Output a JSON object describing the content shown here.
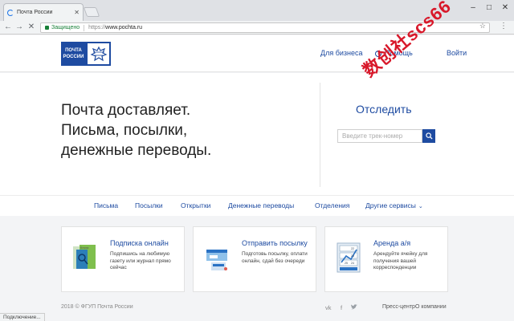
{
  "browser": {
    "tab_title": "Почта России",
    "secure_label": "Защищено",
    "url_protocol": "https://",
    "url_host": "www.pochta.ru",
    "status_text": "Подключение..."
  },
  "header": {
    "logo_line1": "ПОЧТА",
    "logo_line2": "РОССИИ",
    "business_link": "Для бизнеса",
    "help_link": "Помощь",
    "login_link": "Войти"
  },
  "hero": {
    "tagline_line1": "Почта доставляет.",
    "tagline_line2": "Письма, посылки,",
    "tagline_line3": "денежные переводы.",
    "track_title": "Отследить",
    "track_placeholder": "Введите трек-номер"
  },
  "nav": {
    "items": [
      "Письма",
      "Посылки",
      "Открытки",
      "Денежные переводы",
      "Отделения",
      "Другие сервисы"
    ]
  },
  "cards": [
    {
      "title": "Подписка онлайн",
      "desc": "Подпишись на любимую газету или журнал прямо сейчас",
      "illus_label": "Книга"
    },
    {
      "title": "Отправить посылку",
      "desc": "Подготовь посылку, оплати онлайн, сдай без очереди"
    },
    {
      "title": "Аренда а/я",
      "desc": "Арендуйте ячейку для получения вашей корреспонденции",
      "illus_nums": [
        "22",
        "23",
        "24",
        "25"
      ]
    }
  ],
  "footer": {
    "copyright": "2018 © ФГУП Почта России",
    "social": [
      "vk",
      "f",
      "twitter"
    ],
    "press_center": "Пресс-центр",
    "about": "О компании"
  },
  "watermark": "数创社scs66",
  "colors": {
    "brand": "#1e4ba1",
    "secure": "#188038",
    "watermark": "#d8182a"
  }
}
